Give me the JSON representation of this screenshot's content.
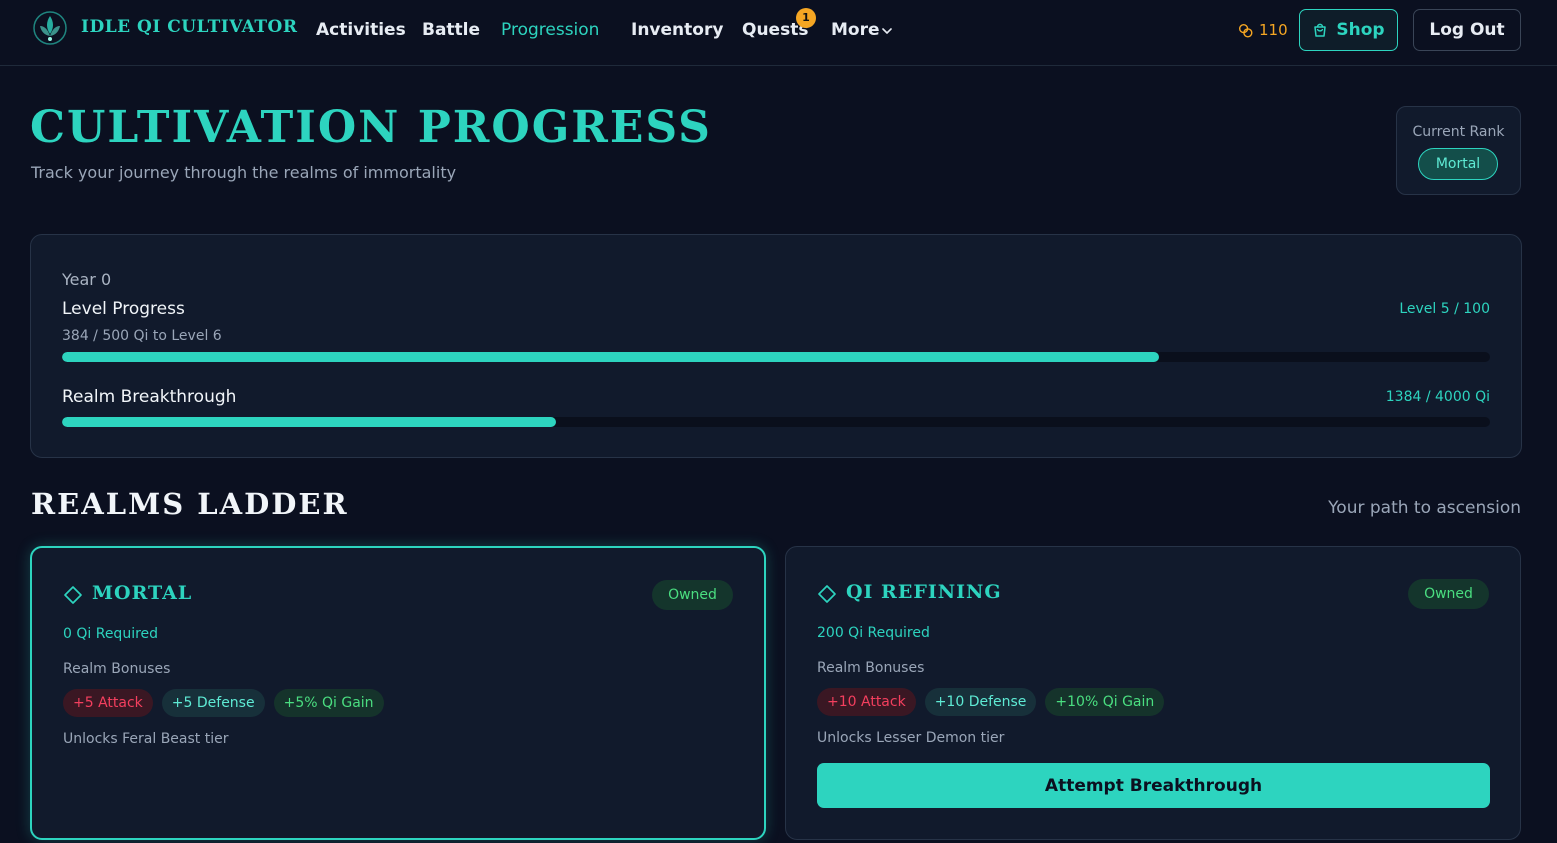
{
  "nav": {
    "brand": "IDLE QI CULTIVATOR",
    "links": [
      {
        "label": "Activities",
        "active": false
      },
      {
        "label": "Battle",
        "active": false
      },
      {
        "label": "Progression",
        "active": true
      },
      {
        "label": "Inventory",
        "active": false
      },
      {
        "label": "Quests",
        "active": false
      },
      {
        "label": "More",
        "active": false
      }
    ],
    "quests_badge": "1",
    "coins": "110",
    "shop_label": "Shop",
    "logout_label": "Log Out"
  },
  "header": {
    "title": "CULTIVATION PROGRESS",
    "subtitle": "Track your journey through the realms of immortality",
    "rank_label": "Current Rank",
    "rank_value": "Mortal"
  },
  "progress": {
    "year": "Year 0",
    "level_title": "Level Progress",
    "level_value": "Level 5 / 100",
    "level_sub": "384 / 500 Qi to Level 6",
    "level_fraction": 0.768,
    "realm_title": "Realm Breakthrough",
    "realm_value": "1384 / 4000 Qi",
    "realm_fraction": 0.346
  },
  "realms": {
    "title": "REALMS LADDER",
    "subtitle": "Your path to ascension",
    "cards": [
      {
        "name": "MORTAL",
        "status": "Owned",
        "required": "0 Qi Required",
        "bonus_label": "Realm Bonuses",
        "bonuses": {
          "attack": "+5 Attack",
          "defense": "+5 Defense",
          "qi": "+5% Qi Gain"
        },
        "unlock": "Unlocks Feral Beast tier"
      },
      {
        "name": "QI REFINING",
        "status": "Owned",
        "required": "200 Qi Required",
        "bonus_label": "Realm Bonuses",
        "bonuses": {
          "attack": "+10 Attack",
          "defense": "+10 Defense",
          "qi": "+10% Qi Gain"
        },
        "unlock": "Unlocks Lesser Demon tier",
        "action": "Attempt Breakthrough"
      }
    ]
  },
  "colors": {
    "accent": "#2dd4bf",
    "background": "#0b1020",
    "panel": "#111a2c",
    "coin": "#f5a623",
    "attack": "#f43f5e",
    "qi_gain": "#4ade80"
  }
}
